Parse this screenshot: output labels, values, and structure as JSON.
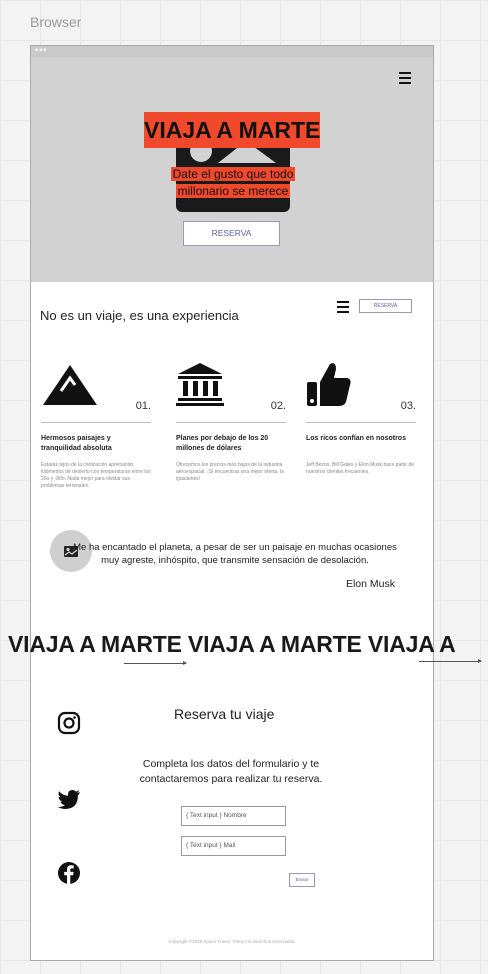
{
  "canvas": {
    "label": "Browser"
  },
  "browser": {
    "chrome_dots": "•••"
  },
  "hero": {
    "title": "VIAJA A MARTE",
    "subtitle": "Date el gusto que todo millonario se merece",
    "button_label": "RESERVA"
  },
  "navbar": {
    "button_label": "RESERVA"
  },
  "section": {
    "title": "No es un viaje, es una experiencia"
  },
  "features": [
    {
      "number": "01.",
      "title": "Hermosos paisajes y tranquilidad absoluta",
      "description": "Estarás lejos de la civilización apreciando kilómetros de desierto con temperaturas entre los 20o y -80o. Nada mejor para olvidar sus problemas terrenales."
    },
    {
      "number": "02.",
      "title": "Planes por debajo de los 20 millones de dólares",
      "description": "Ofrecemos los precios más bajos de la industria aeroespacial. ¡Si encuentras una mejor oferta, la igualamos!"
    },
    {
      "number": "03.",
      "title": "Los ricos confían en nosotros",
      "description": "Jeff Bezos, Bill Gates y Elon Musk hace parte de nuestros clientes frecuentes."
    }
  ],
  "testimonial": {
    "quote": "Me ha encantado el planeta, a pesar de ser un paisaje en muchas ocasiones muy agreste, inhóspito, que transmite sensación de desolación.",
    "author": "Elon Musk"
  },
  "marquee": {
    "text": "VIAJA A MARTE VIAJA A MARTE VIAJA A"
  },
  "form": {
    "title": "Reserva tu viaje",
    "description": "Completa los datos del formulario y te contactaremos para realizar tu reserva.",
    "name_placeholder": "{ Text input } Nombre",
    "mail_placeholder": "{ Text input } Mail",
    "submit_label": "Enviar"
  },
  "footer": {
    "copyright": "Copyright ©2029 Space Travel. Todos los derechos reservados."
  },
  "colors": {
    "accent": "#f0492b",
    "hero_bg": "#d2d2d2",
    "button_text": "#5b5fae"
  },
  "icons": [
    "hamburger-icon",
    "image-icon",
    "mountain-icon",
    "bank-icon",
    "thumbs-up-icon",
    "instagram-icon",
    "twitter-icon",
    "facebook-icon"
  ]
}
